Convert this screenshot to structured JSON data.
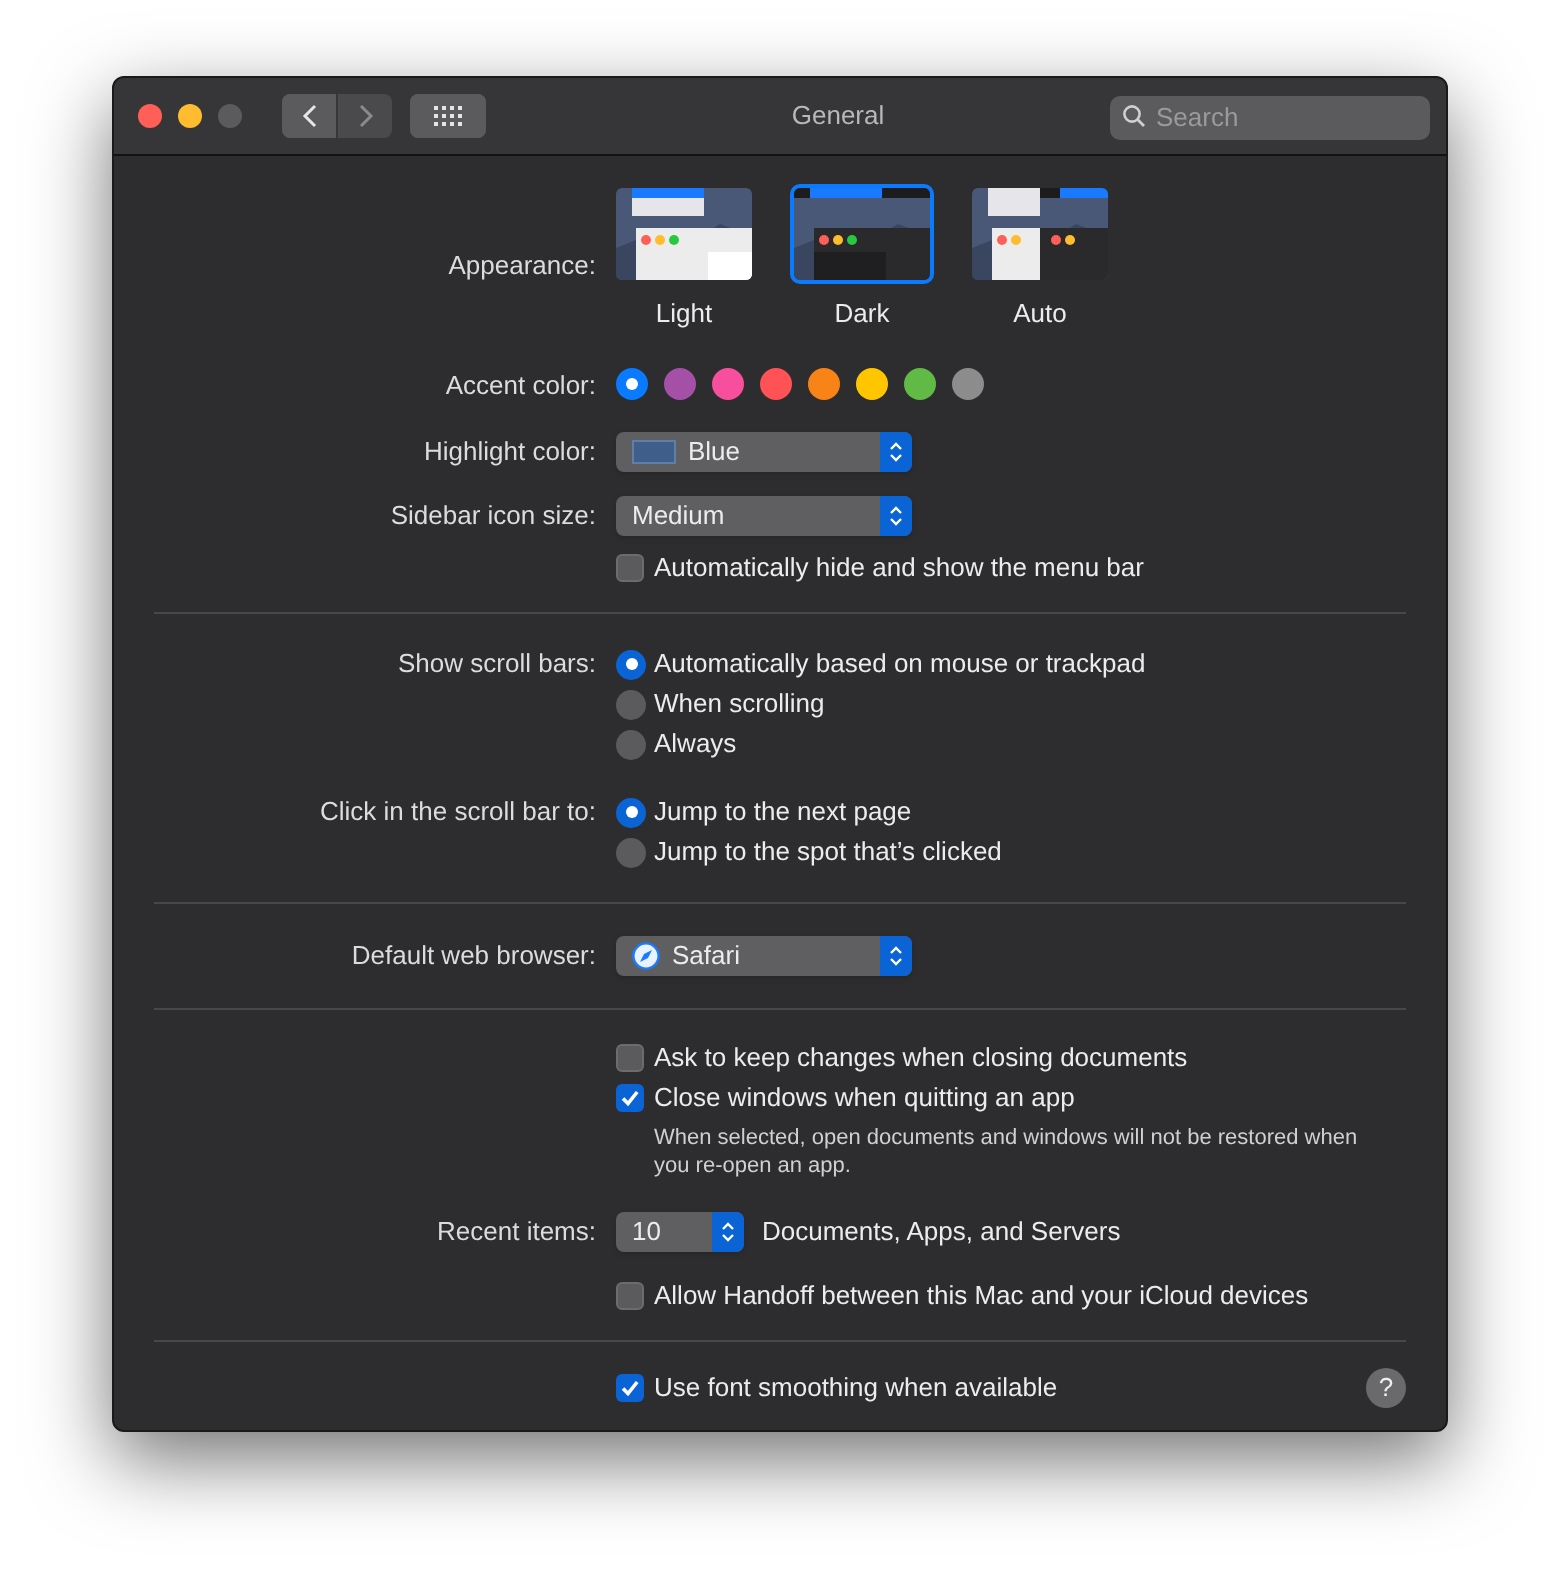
{
  "window": {
    "title": "General",
    "search": {
      "placeholder": "Search"
    },
    "zoom_disabled": true
  },
  "appearance": {
    "label": "Appearance:",
    "options": [
      {
        "label": "Light",
        "kind": "light",
        "selected": false
      },
      {
        "label": "Dark",
        "kind": "dark",
        "selected": true
      },
      {
        "label": "Auto",
        "kind": "auto",
        "selected": false
      }
    ]
  },
  "accent": {
    "label": "Accent color:",
    "colors": [
      {
        "color": "#0a7aff",
        "selected": true
      },
      {
        "color": "#a550a7",
        "selected": false
      },
      {
        "color": "#f74f9e",
        "selected": false
      },
      {
        "color": "#ff5257",
        "selected": false
      },
      {
        "color": "#f88317",
        "selected": false
      },
      {
        "color": "#ffc600",
        "selected": false
      },
      {
        "color": "#62ba46",
        "selected": false
      },
      {
        "color": "#8c8c8c",
        "selected": false
      }
    ]
  },
  "highlight": {
    "label": "Highlight color:",
    "value": "Blue"
  },
  "sidebar_icon_size": {
    "label": "Sidebar icon size:",
    "value": "Medium"
  },
  "menu_bar": {
    "label": "Automatically hide and show the menu bar",
    "checked": false
  },
  "scroll_bars": {
    "label": "Show scroll bars:",
    "options": [
      {
        "label": "Automatically based on mouse or trackpad",
        "selected": true
      },
      {
        "label": "When scrolling",
        "selected": false
      },
      {
        "label": "Always",
        "selected": false
      }
    ]
  },
  "click_scroll_bar": {
    "label": "Click in the scroll bar to:",
    "options": [
      {
        "label": "Jump to the next page",
        "selected": true
      },
      {
        "label": "Jump to the spot that’s clicked",
        "selected": false
      }
    ]
  },
  "browser": {
    "label": "Default web browser:",
    "value": "Safari"
  },
  "documents": [
    {
      "label": "Ask to keep changes when closing documents",
      "checked": false
    },
    {
      "label": "Close windows when quitting an app",
      "checked": true
    }
  ],
  "documents_note": "When selected, open documents and windows will not be restored when you re-open an app.",
  "recent_items": {
    "label": "Recent items:",
    "value": "10",
    "suffix": "Documents, Apps, and Servers"
  },
  "handoff": {
    "label": "Allow Handoff between this Mac and your iCloud devices",
    "checked": false
  },
  "font_smoothing": {
    "label": "Use font smoothing when available",
    "checked": true
  },
  "help": "?"
}
